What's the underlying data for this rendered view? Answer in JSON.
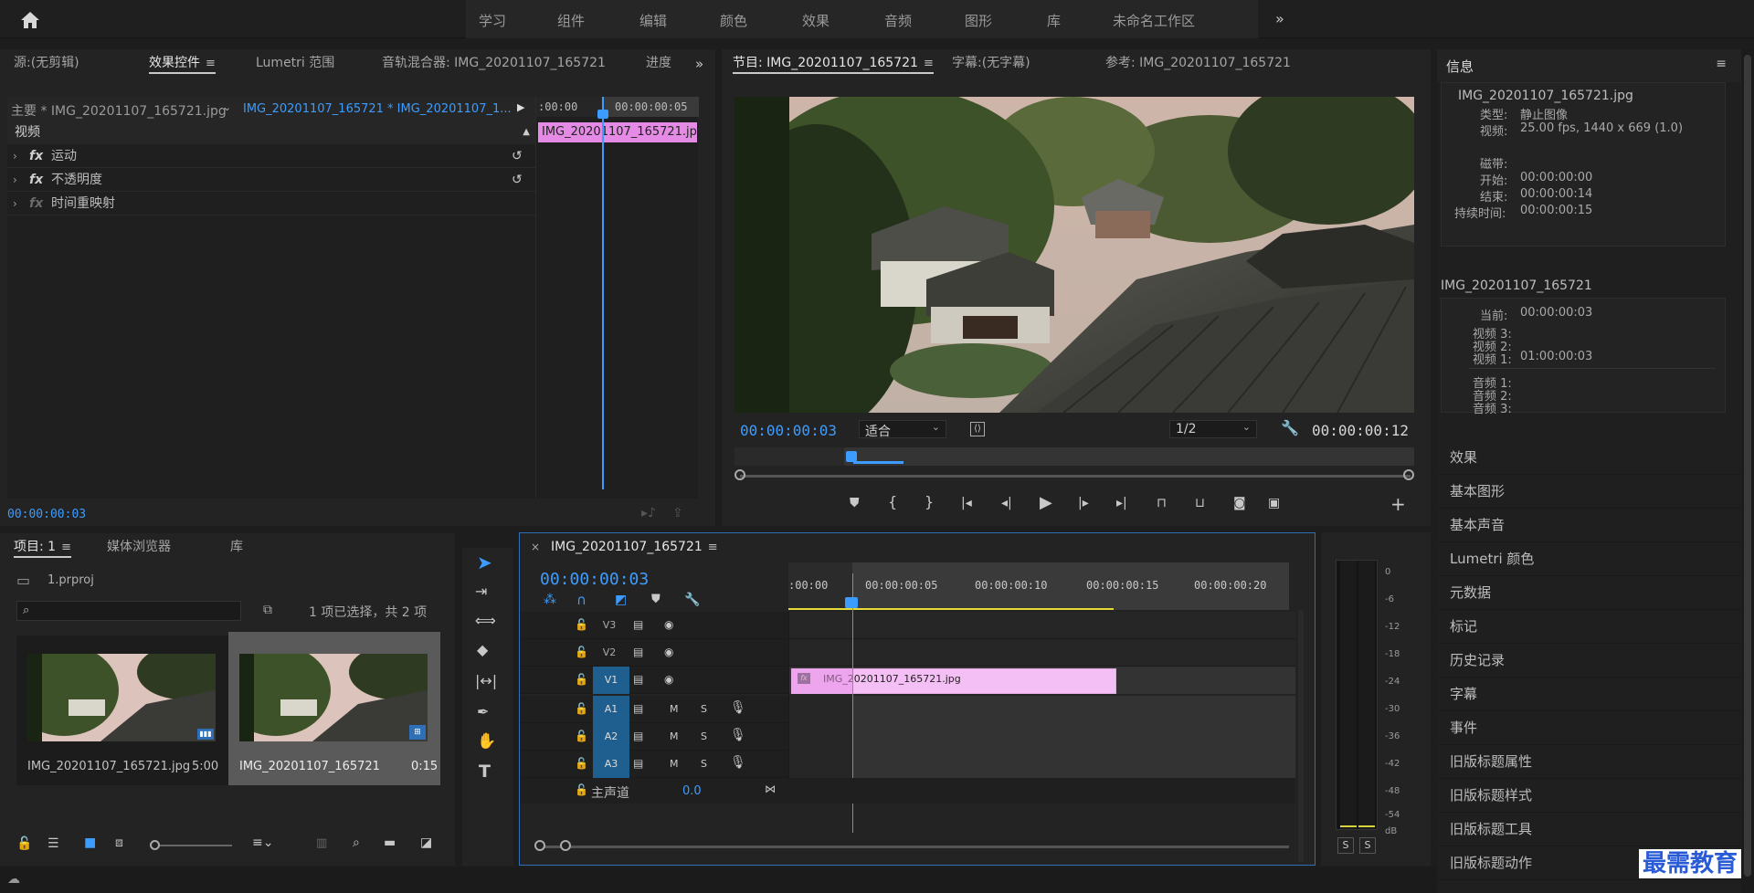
{
  "menu": {
    "items": [
      "学习",
      "组件",
      "编辑",
      "颜色",
      "效果",
      "音频",
      "图形",
      "库",
      "未命名工作区"
    ]
  },
  "source_panel": {
    "tabs": [
      "源:(无剪辑)",
      "效果控件",
      "Lumetri 范围",
      "音轨混合器: IMG_20201107_165721",
      "进度"
    ],
    "clip_select": "主要 * IMG_20201107_165721.jpg",
    "clip_link": "IMG_20201107_165721 * IMG_20201107_1...",
    "time_start": ":00:00",
    "time_end": "00:00:00:05",
    "clip_label": "IMG_20201107_165721.jpg",
    "section": "视频",
    "effects": [
      "运动",
      "不透明度",
      "时间重映射"
    ],
    "fx_label": "fx",
    "timecode": "00:00:00:03"
  },
  "program_panel": {
    "tabs": [
      "节目: IMG_20201107_165721",
      "字幕:(无字幕)",
      "参考: IMG_20201107_165721"
    ],
    "timecode": "00:00:00:03",
    "fit": "适合",
    "resolution": "1/2",
    "duration": "00:00:00:12"
  },
  "info_panel": {
    "title": "信息",
    "filename": "IMG_20201107_165721.jpg",
    "type_label": "类型:",
    "type_value": "静止图像",
    "video_label": "视频:",
    "video_value": "25.00 fps, 1440 x 669 (1.0)",
    "tape_label": "磁带:",
    "start_label": "开始:",
    "start_value": "00:00:00:00",
    "end_label": "结束:",
    "end_value": "00:00:00:14",
    "dur_label": "持续时间:",
    "dur_value": "00:00:00:15",
    "seq_name": "IMG_20201107_165721",
    "current_label": "当前:",
    "current_value": "00:00:00:03",
    "v3": "视频 3:",
    "v2": "视频 2:",
    "v1": "视频 1:",
    "v1_value": "01:00:00:03",
    "a1": "音频 1:",
    "a2": "音频 2:",
    "a3": "音频 3:"
  },
  "side_items": [
    "效果",
    "基本图形",
    "基本声音",
    "Lumetri 颜色",
    "元数据",
    "标记",
    "历史记录",
    "字幕",
    "事件",
    "旧版标题属性",
    "旧版标题样式",
    "旧版标题工具",
    "旧版标题动作"
  ],
  "project_panel": {
    "tabs": [
      "项目: 1",
      "媒体浏览器",
      "库"
    ],
    "project_file": "1.prproj",
    "selection": "1 项已选择，共 2 项",
    "items": [
      {
        "name": "IMG_20201107_165721.jpg",
        "duration": "5:00"
      },
      {
        "name": "IMG_20201107_165721",
        "duration": "0:15"
      }
    ]
  },
  "timeline": {
    "tab": "IMG_20201107_165721",
    "timecode": "00:00:00:03",
    "ruler": [
      ":00:00",
      "00:00:00:05",
      "00:00:00:10",
      "00:00:00:15",
      "00:00:00:20"
    ],
    "video_tracks": [
      "V3",
      "V2",
      "V1"
    ],
    "audio_tracks": [
      "A1",
      "A2",
      "A3"
    ],
    "m_label": "M",
    "s_label": "S",
    "clip_name": "IMG_20201107_165721.jpg",
    "master_label": "主声道",
    "master_value": "0.0"
  },
  "meter": {
    "scale": [
      "0",
      "-6",
      "-12",
      "-18",
      "-24",
      "-30",
      "-36",
      "-42",
      "-48",
      "-54",
      "dB"
    ],
    "solo": [
      "S",
      "S"
    ]
  },
  "watermark": "最需教育",
  "colors": {
    "accent": "#3d9cff",
    "clip": "#f4bff4",
    "clip_fx": "#e58be5",
    "track_label": "#1f5f8f"
  }
}
